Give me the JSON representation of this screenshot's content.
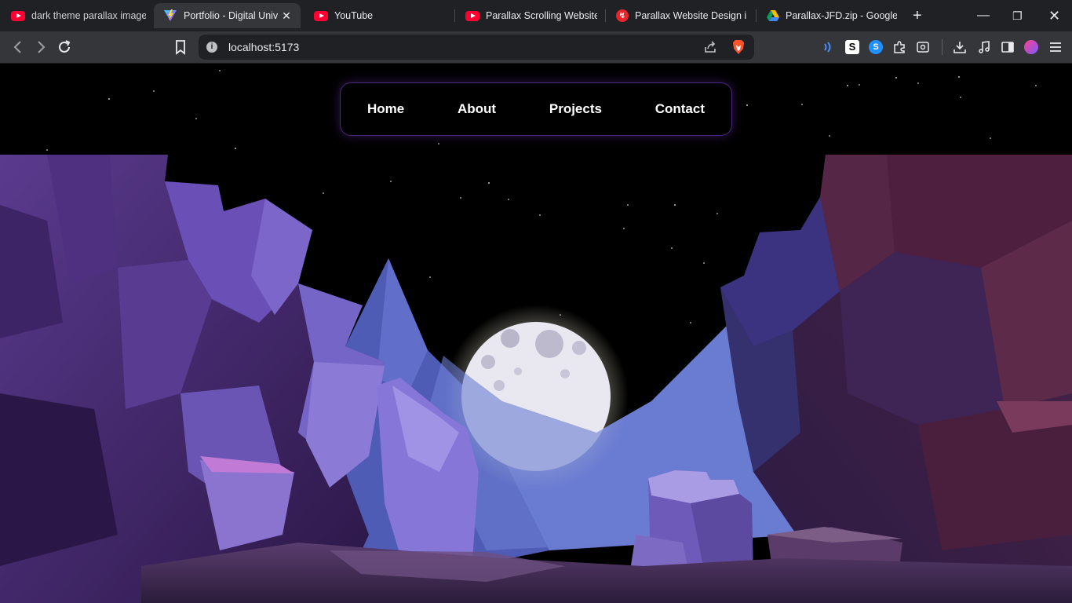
{
  "browser": {
    "tabs": [
      {
        "title": "dark theme parallax image",
        "favicon": "youtube-icon"
      },
      {
        "title": "Portfolio - Digital Univ",
        "favicon": "vite-icon",
        "active": true
      },
      {
        "title": "YouTube",
        "favicon": "youtube-icon"
      },
      {
        "title": "Parallax Scrolling Website u",
        "favicon": "youtube-icon"
      },
      {
        "title": "Parallax Website Design in",
        "favicon": "red-circle-icon"
      },
      {
        "title": "Parallax-JFD.zip - Google D",
        "favicon": "google-drive-icon"
      }
    ],
    "address": "localhost:5173"
  },
  "site": {
    "nav": {
      "home": "Home",
      "about": "About",
      "projects": "Projects",
      "contact": "Contact"
    }
  },
  "colors": {
    "accent": "#8c46e6",
    "background": "#000000",
    "rock_purple": "#6b4fb0",
    "mountain_blue": "#5f6fc4",
    "moon": "#e6e4ee"
  }
}
